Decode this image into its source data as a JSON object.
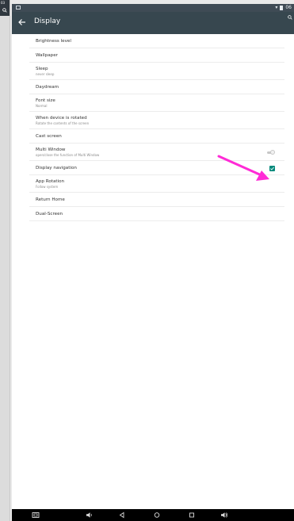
{
  "toolbar": {
    "title": "Display"
  },
  "statusbar": {
    "left_text": "",
    "right_text": "06"
  },
  "left_strip": {
    "text": "03"
  },
  "settings": [
    {
      "title": "Brightness level",
      "subtitle": ""
    },
    {
      "title": "Wallpaper",
      "subtitle": ""
    },
    {
      "title": "Sleep",
      "subtitle": "never sleep"
    },
    {
      "title": "Daydream",
      "subtitle": ""
    },
    {
      "title": "Font size",
      "subtitle": "Normal"
    },
    {
      "title": "When device is rotated",
      "subtitle": "Rotate the contents of the screen"
    },
    {
      "title": "Cast screen",
      "subtitle": ""
    },
    {
      "title": "Multi Window",
      "subtitle": "open/close the function of Multi Window",
      "toggle": false
    },
    {
      "title": "Display navigation",
      "subtitle": "",
      "checked": true
    },
    {
      "title": "App Rotation",
      "subtitle": "Follow system"
    },
    {
      "title": "Return Home",
      "subtitle": ""
    },
    {
      "title": "Dual-Screen",
      "subtitle": ""
    }
  ],
  "colors": {
    "toolbar": "#37474f",
    "statusbar": "#3f4b55",
    "accent": "#00897b",
    "annotation_arrow": "#ff2bd6"
  },
  "icons": {
    "back": "arrow-left-icon",
    "search": "search-icon",
    "screenshot": "screenshot-icon",
    "volume_down": "volume-down-icon",
    "back_nav": "back-triangle-icon",
    "home": "home-circle-icon",
    "recents": "recents-square-icon",
    "volume_up": "volume-up-icon"
  }
}
